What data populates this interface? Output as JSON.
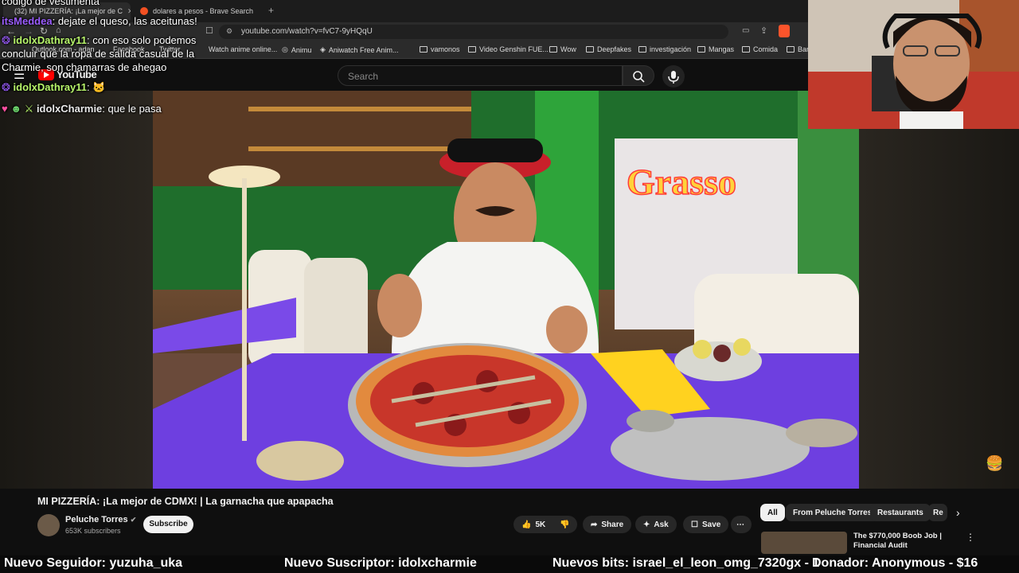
{
  "browser": {
    "tabs": [
      {
        "label": "(32) MI PIZZERÍA: ¡La mejor de C"
      },
      {
        "label": "dolares a pesos - Brave Search"
      }
    ],
    "url": "youtube.com/watch?v=fvC7-9yHQqU",
    "bookmarks": [
      "Outlook.com - adan",
      "Facebook",
      "Twitter",
      "Watch anime online...",
      "Animu",
      "Aniwatch Free Anim...",
      "vamonos",
      "Video Genshin FUE...",
      "Wow",
      "Deepfakes",
      "investigación",
      "Mangas",
      "Comida",
      "Bar"
    ]
  },
  "youtube": {
    "logo": "YouTube",
    "search_placeholder": "Search",
    "video_title": "MI PIZZERÍA: ¡La mejor de CDMX! | La garnacha que apapacha",
    "channel": "Peluche Torres",
    "subscribers": "653K subscribers",
    "subscribe_label": "Subscribe",
    "likes": "5K",
    "share_label": "Share",
    "ask_label": "Ask",
    "save_label": "Save",
    "chips": [
      "All",
      "From Peluche Torres",
      "Restaurants",
      "Re"
    ],
    "recommended_title": "The $770,000 Boob Job | Financial Audit"
  },
  "chat": [
    {
      "user": "",
      "text": "codigo de vestimenta"
    },
    {
      "user": "itsMeddea",
      "text": "dejate el queso, las aceitunas!"
    },
    {
      "user": "idolxDathray11",
      "text": "con eso solo podemos concluir que la ropa de salida casual de la Charmie, son chamarras de ahegao"
    },
    {
      "user": "idolxDathray11",
      "text": ""
    },
    {
      "user": "idolxCharmie",
      "text": "que le pasa"
    }
  ],
  "ticker": {
    "follower": "Nuevo Seguidor: yuzuha_uka",
    "subscriber": "Nuevo Suscriptor: idolxcharmie",
    "bits": "Nuevos bits: israel_el_leon_omg_7320gx - 1",
    "donor": "Donador: Anonymous - $16"
  },
  "colors": {
    "accent_red": "#ff0000",
    "chat_user_green": "#b7f56a",
    "chat_user_purple": "#9b5cff"
  }
}
